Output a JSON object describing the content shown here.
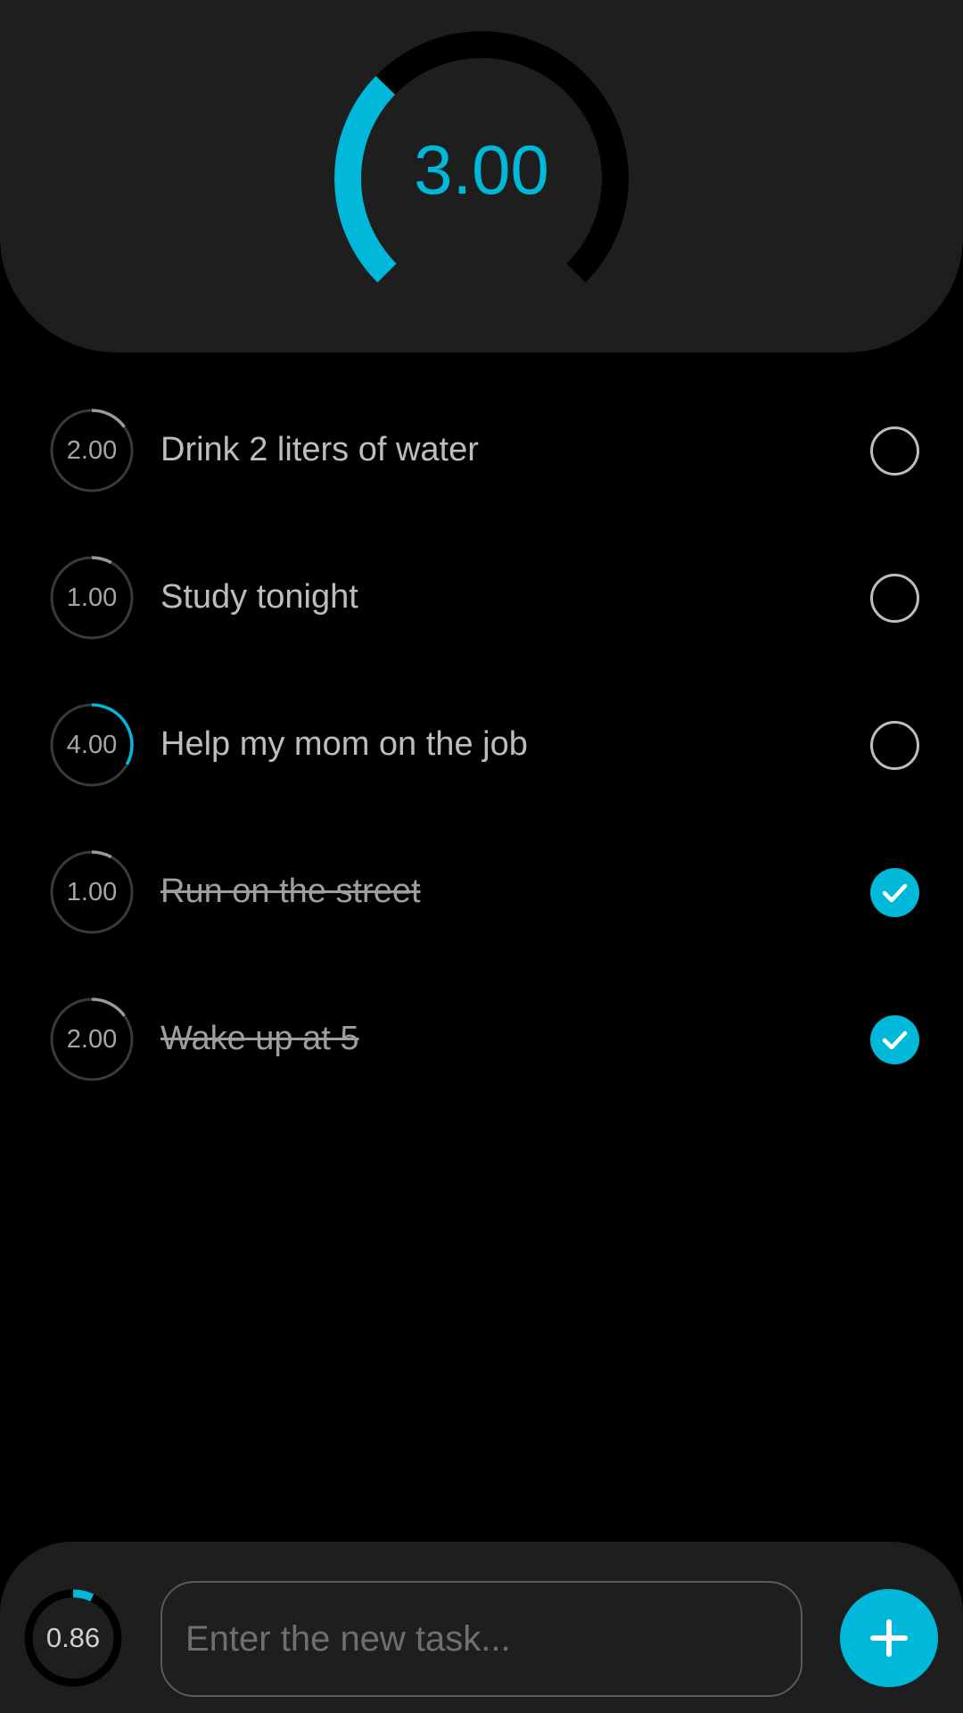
{
  "colors": {
    "accent": "#00b8d9",
    "background": "#000000",
    "panel": "#1e1e1e",
    "track": "#3a3a3a",
    "text": "#bdbdbd"
  },
  "header": {
    "gauge_value": "3.00",
    "gauge_fraction": 0.33
  },
  "tasks": [
    {
      "label": "Drink 2 liters of water",
      "value": "2.00",
      "progress": 0.15,
      "done": false,
      "ring_color": "#9a9a9a"
    },
    {
      "label": "Study tonight",
      "value": "1.00",
      "progress": 0.08,
      "done": false,
      "ring_color": "#9a9a9a"
    },
    {
      "label": "Help my mom on the job",
      "value": "4.00",
      "progress": 0.33,
      "done": false,
      "ring_color": "#00b8d9"
    },
    {
      "label": "Run on the street",
      "value": "1.00",
      "progress": 0.08,
      "done": true,
      "ring_color": "#9a9a9a"
    },
    {
      "label": "Wake up at 5",
      "value": "2.00",
      "progress": 0.15,
      "done": true,
      "ring_color": "#9a9a9a"
    }
  ],
  "footer": {
    "mini_value": "0.86",
    "mini_fraction": 0.07,
    "input_placeholder": "Enter the new task...",
    "input_value": "",
    "add_icon": "plus-icon"
  }
}
